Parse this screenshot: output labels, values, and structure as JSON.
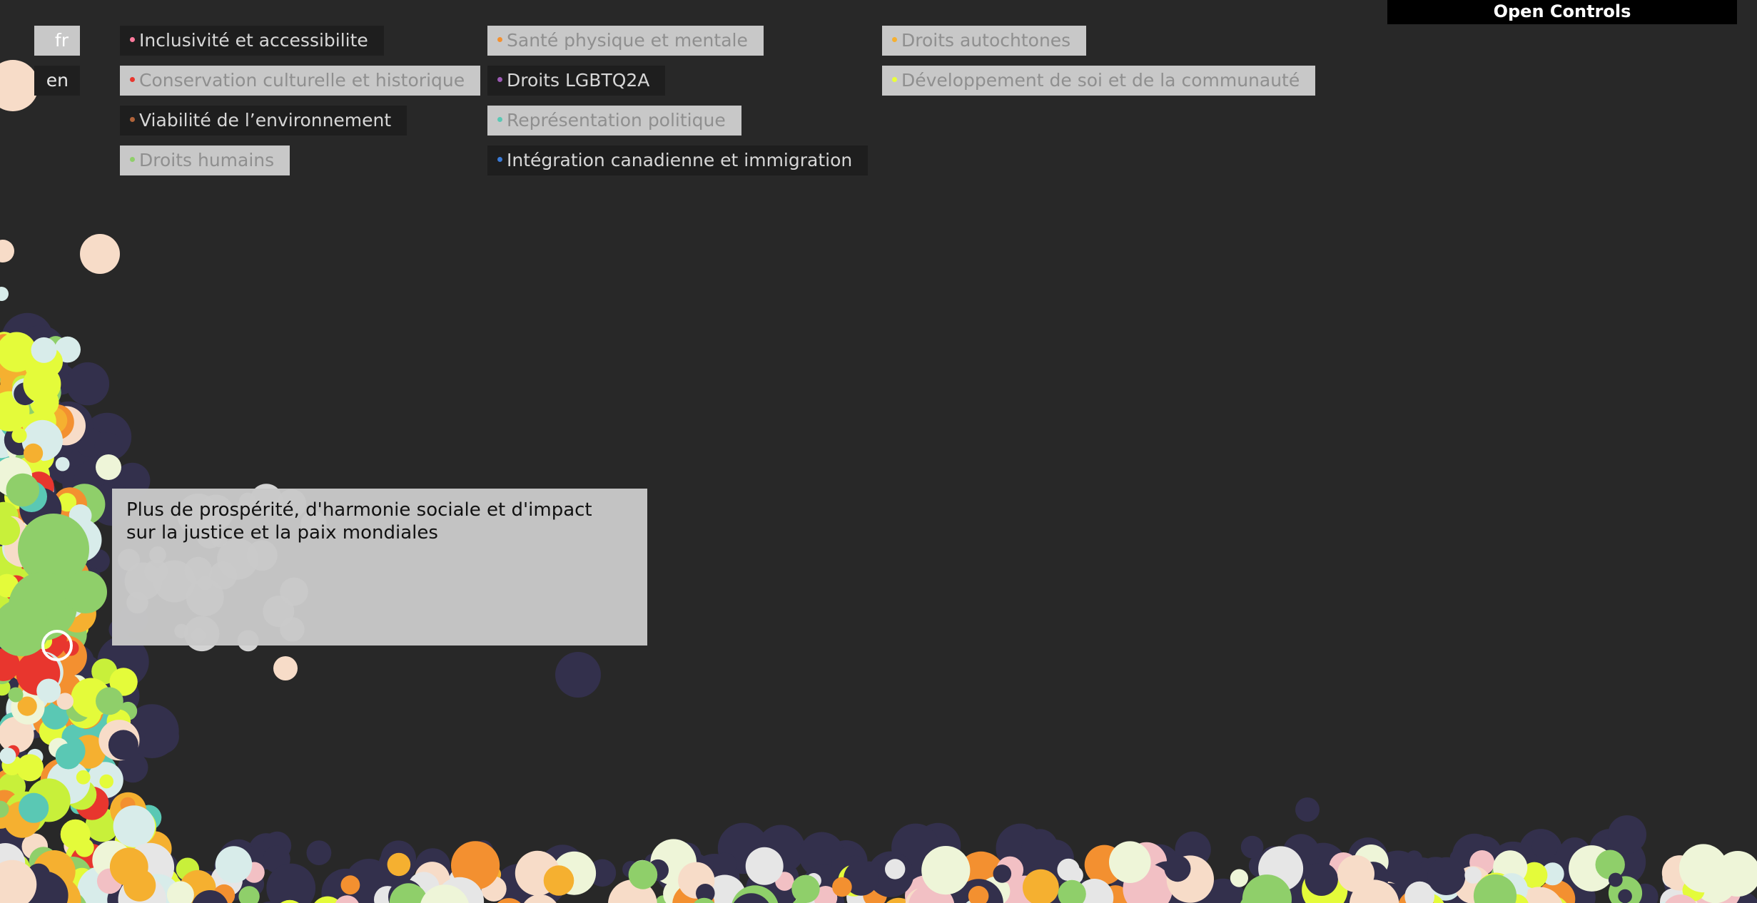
{
  "languages": [
    {
      "label": "fr",
      "active": true
    },
    {
      "label": "en",
      "active": false
    }
  ],
  "categories": [
    {
      "label": "Inclusivité et accessibilite",
      "color": "#ff7a9c",
      "enabled": true
    },
    {
      "label": "Conservation culturelle et historique",
      "color": "#e8362e",
      "enabled": false
    },
    {
      "label": "Viabilité de l’environnement",
      "color": "#b0633a",
      "enabled": true
    },
    {
      "label": "Droits humains",
      "color": "#8fcf6a",
      "enabled": false
    },
    {
      "label": "Santé physique et mentale",
      "color": "#f39030",
      "enabled": false
    },
    {
      "label": "Droits LGBTQ2A",
      "color": "#9c5ab4",
      "enabled": true
    },
    {
      "label": "Représentation politique",
      "color": "#5ac8b4",
      "enabled": false
    },
    {
      "label": "Intégration canadienne et immigration",
      "color": "#3a7ad6",
      "enabled": true
    },
    {
      "label": "Droits autochtones",
      "color": "#f5b030",
      "enabled": false
    },
    {
      "label": "Développement de soi et de la communauté",
      "color": "#eaff3a",
      "enabled": false
    }
  ],
  "controls": {
    "open_label": "Open Controls"
  },
  "tooltip": {
    "text": "Plus de prospérité, d'harmonie sociale et d'impact sur la justice et la paix mondiales"
  },
  "palette": {
    "background": "#282828",
    "navy": "#33304c",
    "lime": "#e4fb3a",
    "yellow_green": "#c8f03a",
    "orange": "#f39030",
    "amber": "#f5b030",
    "green": "#8fcf6a",
    "teal": "#5ac8b4",
    "peach": "#f7dcc8",
    "cream": "#eef5d8",
    "pale_blue": "#d8ecea",
    "pink": "#f2c0c4",
    "red": "#e8362e",
    "white": "#e6e6e6"
  }
}
